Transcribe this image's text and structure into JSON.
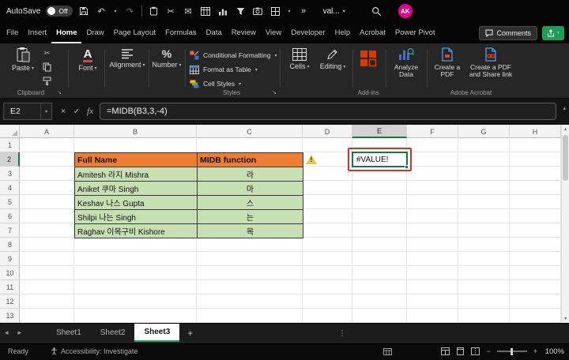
{
  "colors": {
    "accent_green": "#1D9E57",
    "selection_green": "#107C41",
    "header_orange": "#ED7D31",
    "cell_green": "#C6E0B4",
    "annotation_red": "#E0301E",
    "avatar_pink": "#E3008C",
    "warning_yellow": "#F2C243"
  },
  "icons": {
    "chevron_down": "▾",
    "chevron_up": "▴",
    "undo": "↶",
    "redo": "↷",
    "cut": "✂",
    "mail": "✉",
    "overflow": "»",
    "close": "×",
    "check": "✓",
    "fx": "fx",
    "nav_left": "◂",
    "nav_right": "▸",
    "plus": "+",
    "minus": "−",
    "ellipsis_v": "⋮"
  },
  "title_bar": {
    "autosave_label": "AutoSave",
    "autosave_state": "Off",
    "doc_title": "val...",
    "avatar_initials": "AK"
  },
  "ribbon_tabs": {
    "tabs": [
      "File",
      "Insert",
      "Home",
      "Draw",
      "Page Layout",
      "Formulas",
      "Data",
      "Review",
      "View",
      "Developer",
      "Help",
      "Acrobat",
      "Power Pivot"
    ],
    "active": "Home",
    "comments_label": "Comments"
  },
  "ribbon": {
    "paste_label": "Paste",
    "clipboard_group_label": "Clipboard",
    "font_label": "Font",
    "alignment_label": "Alignment",
    "number_label": "Number",
    "conditional_formatting_label": "Conditional Formatting",
    "format_as_table_label": "Format as Table",
    "cell_styles_label": "Cell Styles",
    "styles_group_label": "Styles",
    "cells_label": "Cells",
    "editing_label": "Editing",
    "addins_group_label": "Add-ins",
    "analyze_data_label": "Analyze Data",
    "create_pdf_label": "Create a PDF",
    "create_pdf_share_label": "Create a PDF and Share link",
    "acrobat_group_label": "Adobe Acrobat"
  },
  "formula_bar": {
    "name_box_value": "E2",
    "fx_label": "fx",
    "formula": "=MIDB(B3,3,-4)"
  },
  "grid": {
    "columns": [
      "A",
      "B",
      "C",
      "D",
      "E",
      "F",
      "G",
      "H"
    ],
    "selected_column": "E",
    "rows": [
      "1",
      "2",
      "3",
      "4",
      "5",
      "6",
      "7",
      "8",
      "9",
      "10",
      "11",
      "12",
      "13"
    ],
    "selected_row": "2",
    "table": {
      "headers": [
        "Full Name",
        "MIDB function"
      ],
      "data": [
        [
          "Amitesh 라지 Mishra",
          "라"
        ],
        [
          "Aniket 쿠마 Singh",
          "마"
        ],
        [
          "Keshav 나스 Gupta",
          "스"
        ],
        [
          "Shilpi 나는 Singh",
          "는"
        ],
        [
          "Raghav 이목구비 Kishore",
          "목"
        ]
      ]
    },
    "selected_cell": {
      "ref": "E2",
      "value": "#VALUE!"
    }
  },
  "sheet_bar": {
    "tabs": [
      "Sheet1",
      "Sheet2",
      "Sheet3"
    ],
    "active": "Sheet3"
  },
  "status_bar": {
    "mode": "Ready",
    "accessibility": "Accessibility: Investigate",
    "zoom": "100%"
  }
}
